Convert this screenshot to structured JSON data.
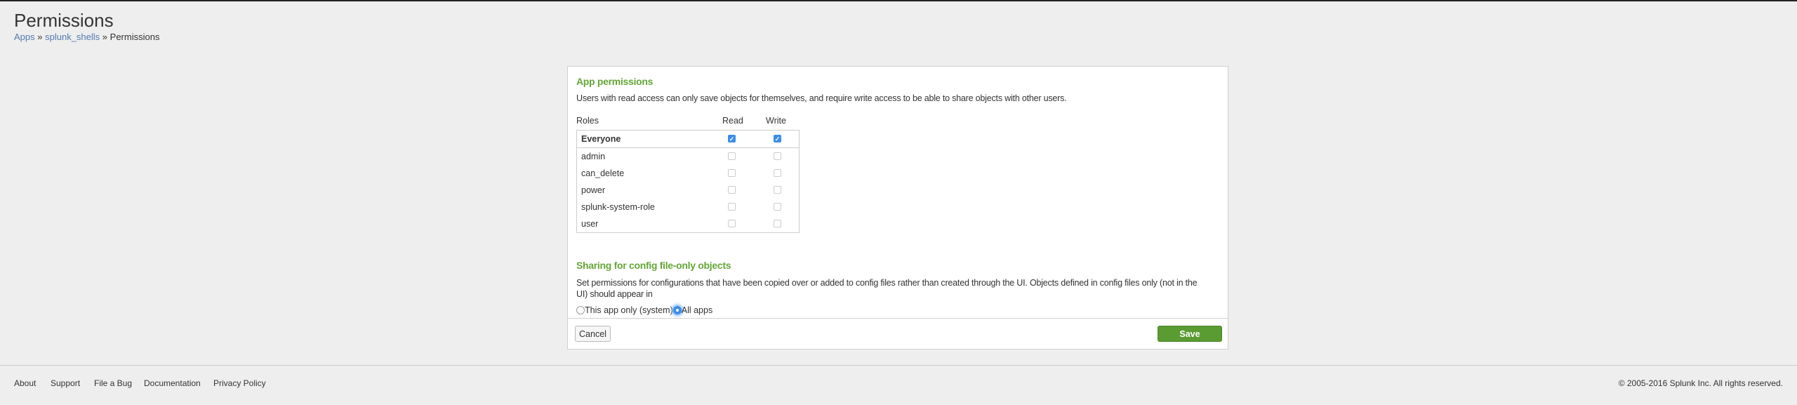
{
  "header": {
    "title": "Permissions",
    "breadcrumb": [
      "Apps",
      "splunk_shells",
      "Permissions"
    ],
    "separator": "»"
  },
  "app_permissions": {
    "heading": "App permissions",
    "description": "Users with read access can only save objects for themselves, and require write access to be able to share objects with other users.",
    "columns": {
      "roles": "Roles",
      "read": "Read",
      "write": "Write"
    },
    "rows": [
      {
        "role": "Everyone",
        "read": true,
        "write": true
      },
      {
        "role": "admin",
        "read": false,
        "write": false
      },
      {
        "role": "can_delete",
        "read": false,
        "write": false
      },
      {
        "role": "power",
        "read": false,
        "write": false
      },
      {
        "role": "splunk-system-role",
        "read": false,
        "write": false
      },
      {
        "role": "user",
        "read": false,
        "write": false
      }
    ]
  },
  "sharing": {
    "heading": "Sharing for config file-only objects",
    "description": "Set permissions for configurations that have been copied over or added to config files rather than created through the UI. Objects defined in config files only (not in the UI) should appear in",
    "options": [
      "This app only (system)",
      "All apps"
    ],
    "selected": "All apps"
  },
  "buttons": {
    "cancel": "Cancel",
    "save": "Save"
  },
  "footer": {
    "links": [
      "About",
      "Support",
      "File a Bug",
      "Documentation",
      "Privacy Policy"
    ],
    "copyright": "© 2005-2016 Splunk Inc. All rights reserved."
  },
  "colors": {
    "accent": "#65a637",
    "save": "#5a9b32",
    "link": "#5379af",
    "checkbox": "#3b8ee8"
  }
}
